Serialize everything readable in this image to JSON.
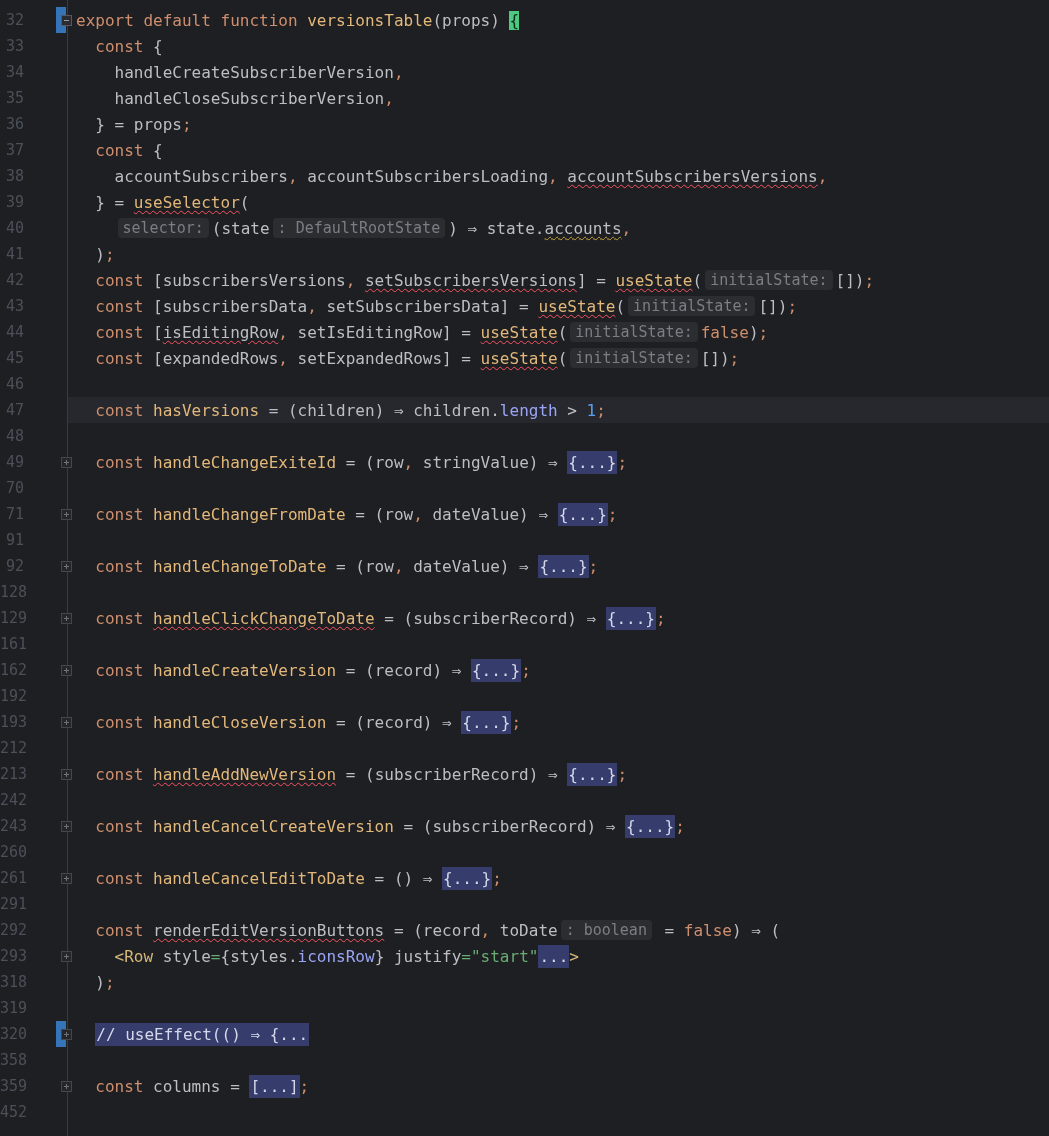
{
  "editor": {
    "lines": [
      {
        "number": "32",
        "folded": false,
        "bookmarked": true,
        "segments": [
          {
            "kind": "code",
            "tokens": [
              {
                "text": "export default function ",
                "kind": "kw"
              },
              {
                "text": "versionsTable",
                "kind": "fn"
              },
              {
                "text": "(props) ",
                "kind": "p"
              },
              {
                "text": "{",
                "kind": "match"
              }
            ]
          }
        ],
        "children": [
          {
            "number": "33",
            "segments": [
              {
                "kind": "code",
                "tokens": [
                  {
                    "text": "const ",
                    "kind": "kw"
                  },
                  {
                    "text": "{",
                    "kind": "p"
                  }
                ]
              }
            ],
            "children": [
              {
                "number": "34",
                "segments": [
                  {
                    "kind": "code",
                    "tokens": [
                      {
                        "text": "handleCreateSubscriberVersion",
                        "kind": "p"
                      },
                      {
                        "text": ",",
                        "kind": "op"
                      }
                    ]
                  }
                ]
              },
              {
                "number": "35",
                "segments": [
                  {
                    "kind": "code",
                    "tokens": [
                      {
                        "text": "handleCloseSubscriberVersion",
                        "kind": "p"
                      },
                      {
                        "text": ",",
                        "kind": "op"
                      }
                    ]
                  }
                ]
              }
            ]
          },
          {
            "number": "36",
            "segments": [
              {
                "kind": "code",
                "tokens": [
                  {
                    "text": "} = props",
                    "kind": "p"
                  },
                  {
                    "text": ";",
                    "kind": "op"
                  }
                ]
              }
            ]
          },
          {
            "number": "37",
            "segments": [
              {
                "kind": "code",
                "tokens": [
                  {
                    "text": "const ",
                    "kind": "kw"
                  },
                  {
                    "text": "{",
                    "kind": "p"
                  }
                ]
              }
            ],
            "children": [
              {
                "number": "38",
                "segments": [
                  {
                    "kind": "code",
                    "tokens": [
                      {
                        "text": "accountSubscribers",
                        "kind": "p"
                      },
                      {
                        "text": ", ",
                        "kind": "op"
                      },
                      {
                        "text": "accountSubscribersLoading",
                        "kind": "p"
                      },
                      {
                        "text": ", ",
                        "kind": "op"
                      },
                      {
                        "text": "accountSubscribersVersions",
                        "kind": "p",
                        "error": true
                      },
                      {
                        "text": ",",
                        "kind": "op"
                      }
                    ]
                  }
                ]
              }
            ]
          },
          {
            "number": "39",
            "segments": [
              {
                "kind": "code",
                "tokens": [
                  {
                    "text": "} = ",
                    "kind": "p"
                  },
                  {
                    "text": "useSelector",
                    "kind": "fn",
                    "error": true
                  },
                  {
                    "text": "(",
                    "kind": "p"
                  }
                ]
              }
            ],
            "children": [
              {
                "number": "40",
                "segments": [
                  {
                    "kind": "hint",
                    "text": "selector:"
                  },
                  {
                    "kind": "code",
                    "tokens": [
                      {
                        "text": "(state",
                        "kind": "p"
                      }
                    ]
                  },
                  {
                    "kind": "hint",
                    "text": ": DefaultRootState"
                  },
                  {
                    "kind": "code",
                    "tokens": [
                      {
                        "text": ") ⇒ state.",
                        "kind": "p"
                      },
                      {
                        "text": "accounts",
                        "kind": "p",
                        "warning": true
                      },
                      {
                        "text": ",",
                        "kind": "op"
                      }
                    ]
                  }
                ]
              }
            ]
          },
          {
            "number": "41",
            "segments": [
              {
                "kind": "code",
                "tokens": [
                  {
                    "text": ")",
                    "kind": "p"
                  },
                  {
                    "text": ";",
                    "kind": "op"
                  }
                ]
              }
            ]
          },
          {
            "number": "42",
            "segments": [
              {
                "kind": "code",
                "tokens": [
                  {
                    "text": "const ",
                    "kind": "kw"
                  },
                  {
                    "text": "[subscribersVersions",
                    "kind": "p"
                  },
                  {
                    "text": ", ",
                    "kind": "op"
                  },
                  {
                    "text": "setSubscribersVersions",
                    "kind": "p",
                    "error": true
                  },
                  {
                    "text": "] = ",
                    "kind": "p"
                  },
                  {
                    "text": "useState",
                    "kind": "fn",
                    "error": true
                  },
                  {
                    "text": "(",
                    "kind": "p"
                  }
                ]
              },
              {
                "kind": "hint",
                "text": "initialState:"
              },
              {
                "kind": "code",
                "tokens": [
                  {
                    "text": "[])",
                    "kind": "p"
                  },
                  {
                    "text": ";",
                    "kind": "op"
                  }
                ]
              }
            ]
          },
          {
            "number": "43",
            "segments": [
              {
                "kind": "code",
                "tokens": [
                  {
                    "text": "const ",
                    "kind": "kw"
                  },
                  {
                    "text": "[subscribersData",
                    "kind": "p"
                  },
                  {
                    "text": ", ",
                    "kind": "op"
                  },
                  {
                    "text": "setSubscribersData] = ",
                    "kind": "p"
                  },
                  {
                    "text": "useState",
                    "kind": "fn",
                    "error": true
                  },
                  {
                    "text": "(",
                    "kind": "p"
                  }
                ]
              },
              {
                "kind": "hint",
                "text": "initialState:"
              },
              {
                "kind": "code",
                "tokens": [
                  {
                    "text": "[])",
                    "kind": "p"
                  },
                  {
                    "text": ";",
                    "kind": "op"
                  }
                ]
              }
            ]
          },
          {
            "number": "44",
            "segments": [
              {
                "kind": "code",
                "tokens": [
                  {
                    "text": "const ",
                    "kind": "kw"
                  },
                  {
                    "text": "[",
                    "kind": "p"
                  },
                  {
                    "text": "isEditingRow",
                    "kind": "p",
                    "error": true
                  },
                  {
                    "text": ", ",
                    "kind": "op"
                  },
                  {
                    "text": "setIsEditingRow] = ",
                    "kind": "p"
                  },
                  {
                    "text": "useState",
                    "kind": "fn",
                    "error": true
                  },
                  {
                    "text": "(",
                    "kind": "p"
                  }
                ]
              },
              {
                "kind": "hint",
                "text": "initialState:"
              },
              {
                "kind": "code",
                "tokens": [
                  {
                    "text": "false",
                    "kind": "kw"
                  },
                  {
                    "text": ")",
                    "kind": "p"
                  },
                  {
                    "text": ";",
                    "kind": "op"
                  }
                ]
              }
            ]
          },
          {
            "number": "45",
            "segments": [
              {
                "kind": "code",
                "tokens": [
                  {
                    "text": "const ",
                    "kind": "kw"
                  },
                  {
                    "text": "[expandedRows",
                    "kind": "p"
                  },
                  {
                    "text": ", ",
                    "kind": "op"
                  },
                  {
                    "text": "setExpandedRows] = ",
                    "kind": "p"
                  },
                  {
                    "text": "useState",
                    "kind": "fn",
                    "error": true
                  },
                  {
                    "text": "(",
                    "kind": "p"
                  }
                ]
              },
              {
                "kind": "hint",
                "text": "initialState:"
              },
              {
                "kind": "code",
                "tokens": [
                  {
                    "text": "[])",
                    "kind": "p"
                  },
                  {
                    "text": ";",
                    "kind": "op"
                  }
                ]
              }
            ]
          },
          {
            "number": "46"
          },
          {
            "number": "47",
            "current": true,
            "segments": [
              {
                "kind": "code",
                "tokens": [
                  {
                    "text": "const ",
                    "kind": "kw"
                  },
                  {
                    "text": "hasVersions",
                    "kind": "fn"
                  },
                  {
                    "text": " = (children) ⇒ children.",
                    "kind": "p"
                  },
                  {
                    "text": "length",
                    "kind": "prop"
                  },
                  {
                    "text": " > ",
                    "kind": "p"
                  },
                  {
                    "text": "1",
                    "kind": "num"
                  },
                  {
                    "text": ";",
                    "kind": "op"
                  }
                ]
              }
            ]
          },
          {
            "number": "48"
          },
          {
            "number": "49",
            "folded": true,
            "segments": [
              {
                "kind": "code",
                "tokens": [
                  {
                    "text": "const ",
                    "kind": "kw"
                  },
                  {
                    "text": "handleChangeExiteId",
                    "kind": "fn"
                  },
                  {
                    "text": " = (row",
                    "kind": "p"
                  },
                  {
                    "text": ", ",
                    "kind": "op"
                  },
                  {
                    "text": "stringValue) ⇒ ",
                    "kind": "p"
                  }
                ]
              },
              {
                "kind": "fold",
                "text": "{...}"
              },
              {
                "kind": "code",
                "tokens": [
                  {
                    "text": ";",
                    "kind": "op"
                  }
                ]
              }
            ]
          },
          {
            "number": "70"
          },
          {
            "number": "71",
            "folded": true,
            "segments": [
              {
                "kind": "code",
                "tokens": [
                  {
                    "text": "const ",
                    "kind": "kw"
                  },
                  {
                    "text": "handleChangeFromDate",
                    "kind": "fn"
                  },
                  {
                    "text": " = (row",
                    "kind": "p"
                  },
                  {
                    "text": ", ",
                    "kind": "op"
                  },
                  {
                    "text": "dateValue) ⇒ ",
                    "kind": "p"
                  }
                ]
              },
              {
                "kind": "fold",
                "text": "{...}"
              },
              {
                "kind": "code",
                "tokens": [
                  {
                    "text": ";",
                    "kind": "op"
                  }
                ]
              }
            ]
          },
          {
            "number": "91"
          },
          {
            "number": "92",
            "folded": true,
            "segments": [
              {
                "kind": "code",
                "tokens": [
                  {
                    "text": "const ",
                    "kind": "kw"
                  },
                  {
                    "text": "handleChangeToDate",
                    "kind": "fn"
                  },
                  {
                    "text": " = (row",
                    "kind": "p"
                  },
                  {
                    "text": ", ",
                    "kind": "op"
                  },
                  {
                    "text": "dateValue) ⇒ ",
                    "kind": "p"
                  }
                ]
              },
              {
                "kind": "fold",
                "text": "{...}"
              },
              {
                "kind": "code",
                "tokens": [
                  {
                    "text": ";",
                    "kind": "op"
                  }
                ]
              }
            ]
          },
          {
            "number": "128"
          },
          {
            "number": "129",
            "folded": true,
            "segments": [
              {
                "kind": "code",
                "tokens": [
                  {
                    "text": "const ",
                    "kind": "kw"
                  },
                  {
                    "text": "handleClickChangeToDate",
                    "kind": "fn",
                    "error": true
                  },
                  {
                    "text": " = (subscriberRecord) ⇒ ",
                    "kind": "p"
                  }
                ]
              },
              {
                "kind": "fold",
                "text": "{...}"
              },
              {
                "kind": "code",
                "tokens": [
                  {
                    "text": ";",
                    "kind": "op"
                  }
                ]
              }
            ]
          },
          {
            "number": "161"
          },
          {
            "number": "162",
            "folded": true,
            "segments": [
              {
                "kind": "code",
                "tokens": [
                  {
                    "text": "const ",
                    "kind": "kw"
                  },
                  {
                    "text": "handleCreateVersion",
                    "kind": "fn"
                  },
                  {
                    "text": " = (record) ⇒ ",
                    "kind": "p"
                  }
                ]
              },
              {
                "kind": "fold",
                "text": "{...}"
              },
              {
                "kind": "code",
                "tokens": [
                  {
                    "text": ";",
                    "kind": "op"
                  }
                ]
              }
            ]
          },
          {
            "number": "192"
          },
          {
            "number": "193",
            "folded": true,
            "segments": [
              {
                "kind": "code",
                "tokens": [
                  {
                    "text": "const ",
                    "kind": "kw"
                  },
                  {
                    "text": "handleCloseVersion",
                    "kind": "fn"
                  },
                  {
                    "text": " = (record) ⇒ ",
                    "kind": "p"
                  }
                ]
              },
              {
                "kind": "fold",
                "text": "{...}"
              },
              {
                "kind": "code",
                "tokens": [
                  {
                    "text": ";",
                    "kind": "op"
                  }
                ]
              }
            ]
          },
          {
            "number": "212"
          },
          {
            "number": "213",
            "folded": true,
            "segments": [
              {
                "kind": "code",
                "tokens": [
                  {
                    "text": "const ",
                    "kind": "kw"
                  },
                  {
                    "text": "handleAddNewVersion",
                    "kind": "fn",
                    "error": true
                  },
                  {
                    "text": " = (subscriberRecord) ⇒ ",
                    "kind": "p"
                  }
                ]
              },
              {
                "kind": "fold",
                "text": "{...}"
              },
              {
                "kind": "code",
                "tokens": [
                  {
                    "text": ";",
                    "kind": "op"
                  }
                ]
              }
            ]
          },
          {
            "number": "242"
          },
          {
            "number": "243",
            "folded": true,
            "segments": [
              {
                "kind": "code",
                "tokens": [
                  {
                    "text": "const ",
                    "kind": "kw"
                  },
                  {
                    "text": "handleCancelCreateVersion",
                    "kind": "fn"
                  },
                  {
                    "text": " = (subscriberRecord) ⇒ ",
                    "kind": "p"
                  }
                ]
              },
              {
                "kind": "fold",
                "text": "{...}"
              },
              {
                "kind": "code",
                "tokens": [
                  {
                    "text": ";",
                    "kind": "op"
                  }
                ]
              }
            ]
          },
          {
            "number": "260"
          },
          {
            "number": "261",
            "folded": true,
            "segments": [
              {
                "kind": "code",
                "tokens": [
                  {
                    "text": "const ",
                    "kind": "kw"
                  },
                  {
                    "text": "handleCancelEditToDate",
                    "kind": "fn"
                  },
                  {
                    "text": " = () ⇒ ",
                    "kind": "p"
                  }
                ]
              },
              {
                "kind": "fold",
                "text": "{...}"
              },
              {
                "kind": "code",
                "tokens": [
                  {
                    "text": ";",
                    "kind": "op"
                  }
                ]
              }
            ]
          },
          {
            "number": "291"
          },
          {
            "number": "292",
            "segments": [
              {
                "kind": "code",
                "tokens": [
                  {
                    "text": "const ",
                    "kind": "kw"
                  },
                  {
                    "text": "renderEditVersionButtons",
                    "kind": "p",
                    "error": true
                  },
                  {
                    "text": " = (record",
                    "kind": "p"
                  },
                  {
                    "text": ", ",
                    "kind": "op"
                  },
                  {
                    "text": "toDate",
                    "kind": "p"
                  }
                ]
              },
              {
                "kind": "hint",
                "text": ": boolean"
              },
              {
                "kind": "code",
                "tokens": [
                  {
                    "text": " = ",
                    "kind": "p"
                  },
                  {
                    "text": "false",
                    "kind": "kw"
                  },
                  {
                    "text": ") ⇒ (",
                    "kind": "p"
                  }
                ]
              }
            ],
            "children": [
              {
                "number": "293",
                "folded": true,
                "segments": [
                  {
                    "kind": "code",
                    "tokens": [
                      {
                        "text": "<Row",
                        "kind": "tag"
                      },
                      {
                        "text": " style",
                        "kind": "p"
                      },
                      {
                        "text": "=",
                        "kind": "str"
                      },
                      {
                        "text": "{styles.",
                        "kind": "p"
                      },
                      {
                        "text": "iconsRow",
                        "kind": "prop"
                      },
                      {
                        "text": "} justify",
                        "kind": "p"
                      },
                      {
                        "text": "=\"start\"",
                        "kind": "str"
                      }
                    ]
                  },
                  {
                    "kind": "fold",
                    "text": "..."
                  },
                  {
                    "kind": "code",
                    "tokens": [
                      {
                        "text": ">",
                        "kind": "tag"
                      }
                    ]
                  }
                ]
              }
            ]
          },
          {
            "number": "318",
            "segments": [
              {
                "kind": "code",
                "tokens": [
                  {
                    "text": ")",
                    "kind": "p"
                  },
                  {
                    "text": ";",
                    "kind": "op"
                  }
                ]
              }
            ]
          },
          {
            "number": "319"
          },
          {
            "number": "320",
            "folded": true,
            "bookmarked": true,
            "segments": [
              {
                "kind": "fold",
                "text": "// useEffect(() ⇒ {..."
              }
            ]
          },
          {
            "number": "358"
          },
          {
            "number": "359",
            "folded": true,
            "segments": [
              {
                "kind": "code",
                "tokens": [
                  {
                    "text": "const ",
                    "kind": "kw"
                  },
                  {
                    "text": "columns = ",
                    "kind": "p"
                  }
                ]
              },
              {
                "kind": "fold",
                "text": "[...]"
              },
              {
                "kind": "code",
                "tokens": [
                  {
                    "text": ";",
                    "kind": "op"
                  }
                ]
              }
            ]
          },
          {
            "number": "452"
          }
        ]
      }
    ]
  }
}
